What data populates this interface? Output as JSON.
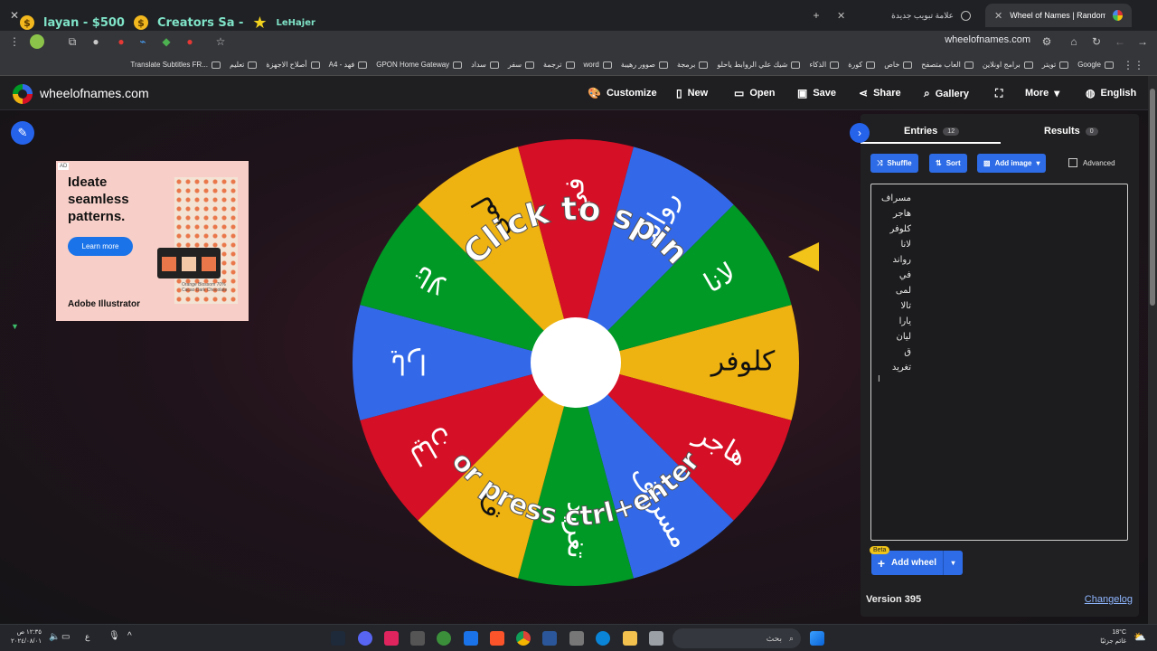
{
  "browser": {
    "tabs": [
      {
        "title": "Wheel of Names | Random name picker"
      },
      {
        "title": "علامة تبويب جديدة"
      }
    ],
    "new_tab": "+",
    "url": "wheelofnames.com",
    "stream_overlay": {
      "donor": "layan - $500",
      "ticker": "Creators Sa -",
      "user": "LeHajer"
    },
    "bookmarks": [
      "Google",
      "تويتر",
      "برامج اونلاين",
      "العاب متصفح",
      "خاص",
      "كورة",
      "الذكاء",
      "شيك علي الروابط ياحلو",
      "برمجة",
      "صوور رهيبة",
      "word",
      "ترجمة",
      "سفر",
      "سداد",
      "GPON Home Gateway",
      "A4 - فهد",
      "أصلاح الاجهزة",
      "تعليم",
      "Translate Subtitles FR..."
    ]
  },
  "header": {
    "site_name": "wheelofnames.com",
    "nav": {
      "customize": "Customize",
      "new": "New",
      "open": "Open",
      "save": "Save",
      "share": "Share",
      "gallery": "Gallery",
      "more": "More",
      "language": "English"
    }
  },
  "ad": {
    "label": "AD",
    "headline": "Ideate seamless patterns.",
    "cta": "Learn more",
    "brand": "Adobe Illustrator",
    "pack_text": "Orange Blossom 70% Cacao Dark Chocolate"
  },
  "wheel": {
    "prompt_top": "Click to spin",
    "prompt_bottom": "or press ctrl+enter",
    "segments": [
      {
        "label": "كلوفر",
        "color": "#eeb211"
      },
      {
        "label": "هاجر",
        "color": "#d50f25"
      },
      {
        "label": "مسراف",
        "color": "#3369e8"
      },
      {
        "label": "تغريد",
        "color": "#009925"
      },
      {
        "label": "ق",
        "color": "#eeb211"
      },
      {
        "label": "ليان",
        "color": "#d50f25"
      },
      {
        "label": "يارا",
        "color": "#3369e8"
      },
      {
        "label": "تالا",
        "color": "#009925"
      },
      {
        "label": "لمى",
        "color": "#eeb211"
      },
      {
        "label": "في",
        "color": "#d50f25"
      },
      {
        "label": "رواند",
        "color": "#3369e8"
      },
      {
        "label": "لانا",
        "color": "#009925"
      }
    ]
  },
  "panel": {
    "tabs": {
      "entries": "Entries",
      "entries_count": "12",
      "results": "Results",
      "results_count": "0"
    },
    "buttons": {
      "shuffle": "Shuffle",
      "sort": "Sort",
      "add_image": "Add image",
      "advanced": "Advanced"
    },
    "entries": [
      "مسراف",
      "هاجر",
      "كلوفر",
      "لانا",
      "رواند",
      "في",
      "لمى",
      "تالا",
      "يارا",
      "ليان",
      "ق",
      "تغريد"
    ],
    "beta": "Beta",
    "add_wheel": "Add wheel",
    "version": "Version 395",
    "changelog": "Changelog"
  },
  "taskbar": {
    "search_placeholder": "بحث",
    "time": "١٢:٣٥ ص",
    "date": "٢٠٢٤/٠٨/٠١",
    "temperature": "18°C",
    "weather": "غائم جزئيًا",
    "lang": "ع"
  },
  "colors": {
    "accent": "#2d6ce6",
    "pointer": "#f2c318"
  }
}
